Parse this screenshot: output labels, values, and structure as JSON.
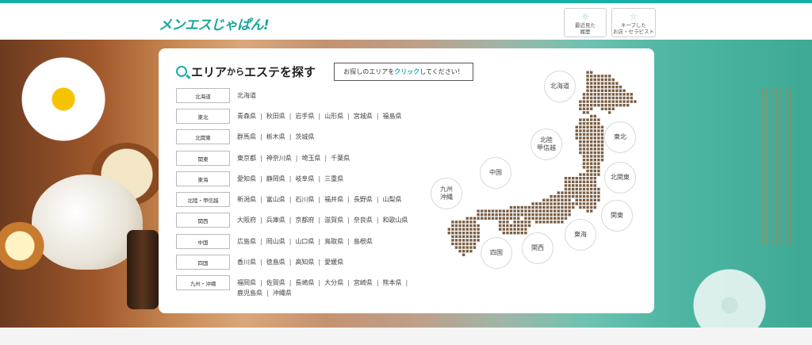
{
  "header": {
    "logo": "メンエスじゃぱん!",
    "recent_button": {
      "line1": "最近見た",
      "line2": "履歴",
      "icon": "sun-icon"
    },
    "saved_button": {
      "line1": "キープした",
      "line2": "お店・セラピスト",
      "icon": "star-icon"
    }
  },
  "search_panel": {
    "title_part1": "エリア",
    "title_part2": "から",
    "title_part3": "エステを探す",
    "hint_before": "お探しのエリアを",
    "hint_highlight": "クリック",
    "hint_after": "してください！"
  },
  "regions": [
    {
      "label": "北海道",
      "prefectures": [
        "北海道"
      ]
    },
    {
      "label": "東北",
      "prefectures": [
        "青森県",
        "秋田県",
        "岩手県",
        "山形県",
        "宮城県",
        "福島県"
      ]
    },
    {
      "label": "北関東",
      "prefectures": [
        "群馬県",
        "栃木県",
        "茨城県"
      ]
    },
    {
      "label": "関東",
      "prefectures": [
        "東京都",
        "神奈川県",
        "埼玉県",
        "千葉県"
      ]
    },
    {
      "label": "東海",
      "prefectures": [
        "愛知県",
        "静岡県",
        "岐阜県",
        "三重県"
      ]
    },
    {
      "label": "北陸・甲信越",
      "prefectures": [
        "新潟県",
        "富山県",
        "石川県",
        "福井県",
        "長野県",
        "山梨県"
      ]
    },
    {
      "label": "関西",
      "prefectures": [
        "大阪府",
        "兵庫県",
        "京都府",
        "滋賀県",
        "奈良県",
        "和歌山県"
      ]
    },
    {
      "label": "中国",
      "prefectures": [
        "広島県",
        "岡山県",
        "山口県",
        "鳥取県",
        "島根県"
      ]
    },
    {
      "label": "四国",
      "prefectures": [
        "香川県",
        "徳島県",
        "高知県",
        "愛媛県"
      ]
    },
    {
      "label": "九州・沖縄",
      "prefectures": [
        "福岡県",
        "佐賀県",
        "長崎県",
        "大分県",
        "宮崎県",
        "熊本県",
        "鹿児島県",
        "沖縄県"
      ]
    }
  ],
  "map_regions": {
    "hokkaido": "北海道",
    "tohoku": "東北",
    "kitakanto": "北関東",
    "kanto": "関東",
    "tokai": "東海",
    "kansai": "関西",
    "shikoku": "四国",
    "chugoku": "中国",
    "kyushu_line1": "九州",
    "kyushu_line2": "沖縄",
    "hokuriku_line1": "北陸",
    "hokuriku_line2": "甲信越"
  },
  "colors": {
    "accent": "#19b0a4",
    "map_dot": "#7a5f45"
  }
}
